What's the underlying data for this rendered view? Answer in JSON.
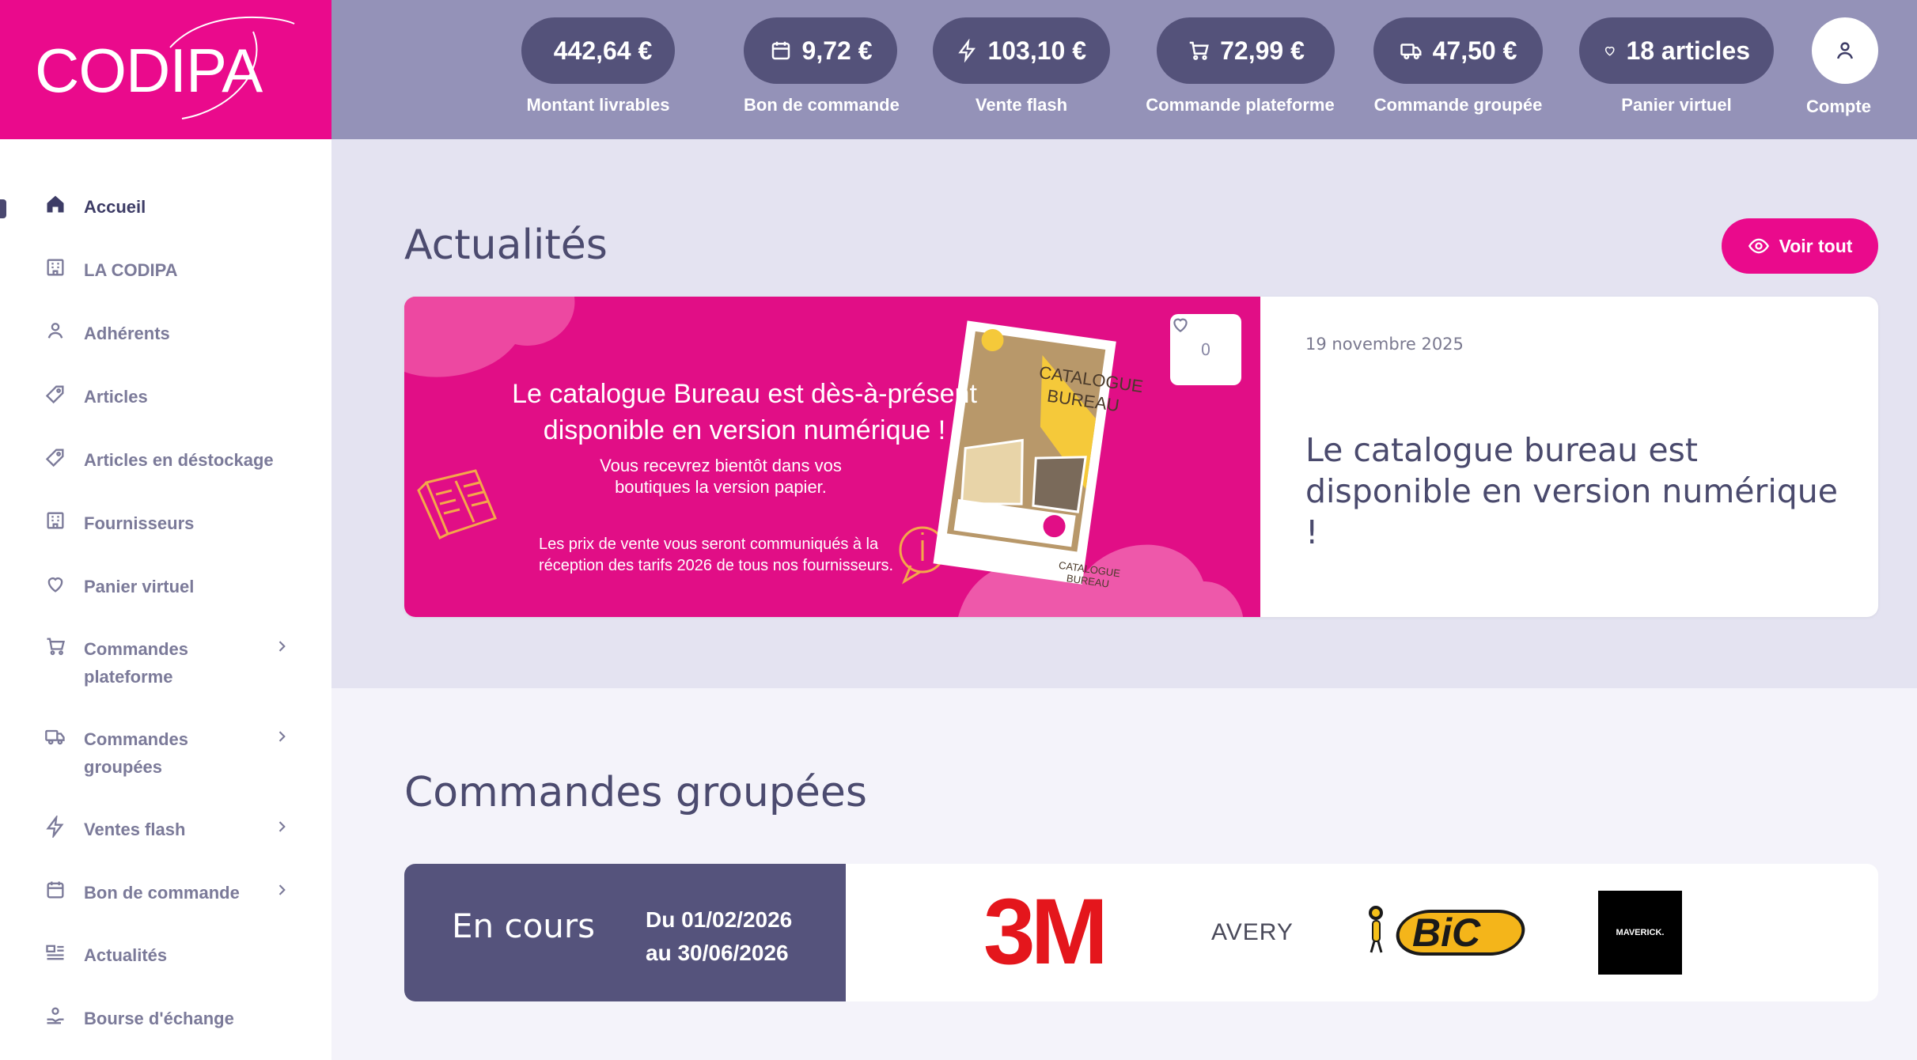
{
  "logo": {
    "text": "CODIPA"
  },
  "stats": [
    {
      "value": "442,64 €",
      "label": "Montant livrables",
      "icon": "timer-icon"
    },
    {
      "value": "9,72 €",
      "label": "Bon de commande",
      "icon": "calendar-icon"
    },
    {
      "value": "103,10 €",
      "label": "Vente flash",
      "icon": "lightning-icon"
    },
    {
      "value": "72,99 €",
      "label": "Commande plateforme",
      "icon": "cart-icon"
    },
    {
      "value": "47,50 €",
      "label": "Commande groupée",
      "icon": "truck-icon"
    },
    {
      "value": "18 articles",
      "label": "Panier virtuel",
      "icon": "heart-icon"
    }
  ],
  "account": {
    "label": "Compte",
    "icon": "user-icon"
  },
  "sidebar": {
    "items": [
      {
        "label": "Accueil",
        "icon": "home-icon"
      },
      {
        "label": "LA CODIPA",
        "icon": "building-icon"
      },
      {
        "label": "Adhérents",
        "icon": "user-icon"
      },
      {
        "label": "Articles",
        "icon": "tag-icon"
      },
      {
        "label": "Articles en déstockage",
        "icon": "tag-icon"
      },
      {
        "label": "Fournisseurs",
        "icon": "building-icon"
      },
      {
        "label": "Panier virtuel",
        "icon": "heart-icon"
      },
      {
        "label": "Commandes plateforme",
        "icon": "cart-icon"
      },
      {
        "label": "Commandes groupées",
        "icon": "truck-icon"
      },
      {
        "label": "Ventes flash",
        "icon": "lightning-icon"
      },
      {
        "label": "Bon de commande",
        "icon": "calendar-icon"
      },
      {
        "label": "Actualités",
        "icon": "news-icon"
      },
      {
        "label": "Bourse d'échange",
        "icon": "exchange-icon"
      }
    ]
  },
  "news": {
    "title": "Actualités",
    "see_all": "Voir tout",
    "item": {
      "date": "19 novembre 2025",
      "title": "Le catalogue bureau est disponible en version numérique !",
      "likes": "0",
      "image": {
        "headline": "Le catalogue Bureau est dès-à-présent disponible en version numérique !",
        "subline": "Vous recevrez bientôt dans vos boutiques la version papier.",
        "note": "Les prix de vente vous seront communiqués à la réception des tarifs 2026 de tous nos fournisseurs.",
        "catalogue_title": "CATALOGUE BUREAU",
        "catalogue_footer": "CATALOGUE BUREAU"
      }
    }
  },
  "grouped": {
    "title": "Commandes groupées",
    "status": "En cours",
    "date_from": "Du 01/02/2026",
    "date_to": "au 30/06/2026",
    "brands": [
      "3M",
      "AVERY",
      "BiC",
      "MAVERICK."
    ]
  },
  "colors": {
    "brand": "#ea0a8c",
    "topbar": "#9492b8",
    "pill": "#54527a",
    "dark": "#55537c"
  }
}
